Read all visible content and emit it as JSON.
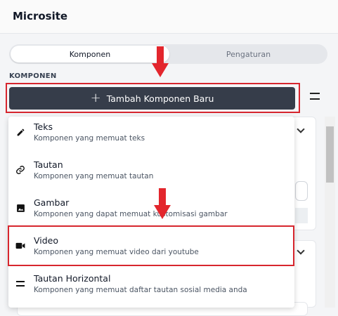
{
  "header": {
    "title": "Microsite"
  },
  "tabs": [
    {
      "label": "Komponen",
      "active": true
    },
    {
      "label": "Pengaturan",
      "active": false
    }
  ],
  "section_label": "KOMPONEN",
  "add_button": {
    "label": "Tambah Komponen Baru",
    "icon": "plus-icon"
  },
  "dropdown": {
    "items": [
      {
        "name": "Teks",
        "desc": "Komponen yang memuat teks",
        "icon": "pencil-icon"
      },
      {
        "name": "Tautan",
        "desc": "Komponen yang memuat tautan",
        "icon": "link-icon"
      },
      {
        "name": "Gambar",
        "desc": "Komponen yang dapat memuat kustomisasi gambar",
        "icon": "image-icon"
      },
      {
        "name": "Video",
        "desc": "Komponen yang memuat video dari youtube",
        "icon": "video-icon"
      },
      {
        "name": "Tautan Horizontal",
        "desc": "Komponen yang memuat daftar tautan sosial media anda",
        "icon": "horizontal-lines-icon"
      }
    ]
  },
  "colors": {
    "highlight": "#d7262e",
    "button": "#363d4a"
  }
}
